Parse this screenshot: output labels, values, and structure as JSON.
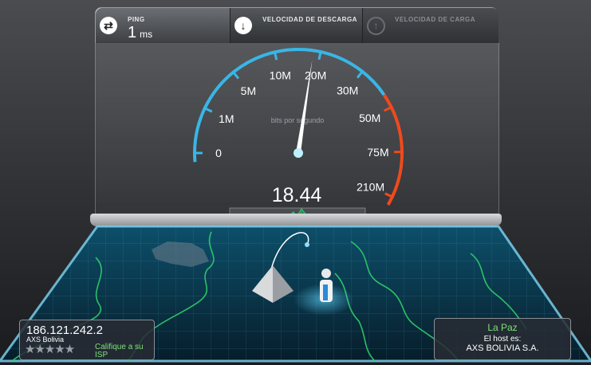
{
  "ping": {
    "label": "PING",
    "value": "1",
    "unit": "ms",
    "icon": "swap-arrows-icon"
  },
  "download": {
    "label": "VELOCIDAD DE DESCARGA",
    "icon": "download-arrow-icon"
  },
  "upload": {
    "label": "VELOCIDAD DE CARGA",
    "icon": "upload-arrow-icon"
  },
  "gauge": {
    "subtitle": "bits por segundo",
    "reading": "18.44",
    "ticks": [
      "0",
      "1M",
      "5M",
      "10M",
      "20M",
      "30M",
      "50M",
      "75M",
      "210M"
    ],
    "needle_value": 18.44,
    "accent": "#39b6e6",
    "danger": "#f04a1c"
  },
  "client": {
    "ip": "186.121.242.2",
    "isp": "AXS Bolivia",
    "stars": "★★★★★",
    "rate_label": "Califique a su ISP"
  },
  "server": {
    "city": "La Paz",
    "host_label": "El host es:",
    "host_name": "AXS BOLIVIA S.A."
  },
  "colors": {
    "map_lines": "#2fd06a",
    "grid": "#3fa4c8",
    "progress": "#2fd06a"
  }
}
